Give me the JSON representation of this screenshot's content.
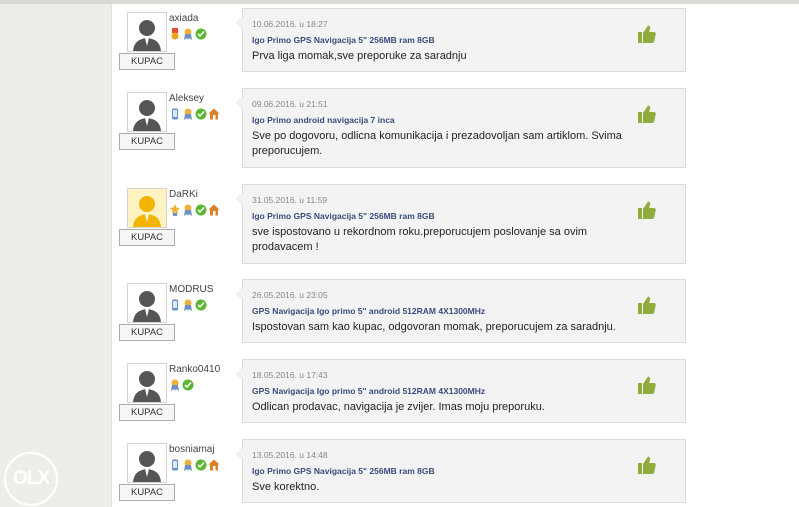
{
  "brand": {
    "logo_text": "OLX"
  },
  "colors": {
    "thumb": "#8fad3f",
    "product_link": "#3a4b7c",
    "card_bg": "#f3f3f3",
    "sidebar_bg": "#eeeee9"
  },
  "role_label": "KUPAC",
  "reviews": [
    {
      "username": "axiada",
      "date": "10.06.2016. u 18:27",
      "product": "Igo Primo GPS Navigacija 5\" 256MB ram 8GB",
      "comment": "Prva liga momak,sve preporuke za saradnju",
      "avatar": "gray-user",
      "badges": [
        "medal-icon",
        "ribbon-icon",
        "check-icon"
      ],
      "rating": "thumbs-up-icon"
    },
    {
      "username": "Aleksey",
      "date": "09.06.2016. u 21:51",
      "product": "Igo Primo android navigacija 7 inca",
      "comment": "Sve po dogovoru, odlicna komunikacija i prezadovoljan sam artiklom. Svima preporucujem.",
      "avatar": "gray-user",
      "badges": [
        "phone-icon",
        "ribbon-icon",
        "check-icon",
        "house-icon"
      ],
      "rating": "thumbs-up-icon"
    },
    {
      "username": "DaRKi",
      "date": "31.05.2016. u 11:59",
      "product": "Igo Primo GPS Navigacija 5\" 256MB ram 8GB",
      "comment": "sve ispostovano u rekordnom roku.preporucujem poslovanje sa ovim prodavacem !",
      "avatar": "gold-user",
      "badges": [
        "star-ribbon-icon",
        "ribbon-icon",
        "check-icon",
        "house-icon"
      ],
      "rating": "thumbs-up-icon"
    },
    {
      "username": "MODRUS",
      "date": "26.05.2016. u 23:05",
      "product": "GPS Navigacija Igo primo 5\" android 512RAM 4X1300MHz",
      "comment": "Ispostovan sam kao kupac, odgovoran momak, preporucujem za saradnju.",
      "avatar": "gray-user",
      "badges": [
        "phone-icon",
        "ribbon-icon",
        "check-icon"
      ],
      "rating": "thumbs-up-icon"
    },
    {
      "username": "Ranko0410",
      "date": "18.05.2016. u 17:43",
      "product": "GPS Navigacija Igo primo 5\" android 512RAM 4X1300MHz",
      "comment": "Odlican prodavac, navigacija je zvijer. Imas moju preporuku.",
      "avatar": "gray-user",
      "badges": [
        "ribbon-icon",
        "check-icon"
      ],
      "rating": "thumbs-up-icon"
    },
    {
      "username": "bosniamaj",
      "date": "13.05.2016. u 14:48",
      "product": "Igo Primo GPS Navigacija 5\" 256MB ram 8GB",
      "comment": "Sve korektno.",
      "avatar": "gray-user",
      "badges": [
        "phone-icon",
        "ribbon-icon",
        "check-icon",
        "house-icon"
      ],
      "rating": "thumbs-up-icon"
    }
  ]
}
